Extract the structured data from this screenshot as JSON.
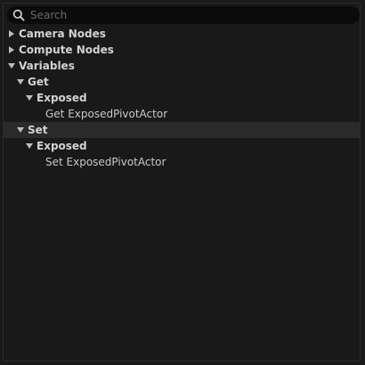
{
  "search": {
    "placeholder": "Search"
  },
  "tree": {
    "camera_nodes": "Camera Nodes",
    "compute_nodes": "Compute Nodes",
    "variables": "Variables",
    "get": "Get",
    "get_exposed": "Exposed",
    "get_exposed_pivot_actor": "Get ExposedPivotActor",
    "set": "Set",
    "set_exposed": "Exposed",
    "set_exposed_pivot_actor": "Set ExposedPivotActor"
  }
}
